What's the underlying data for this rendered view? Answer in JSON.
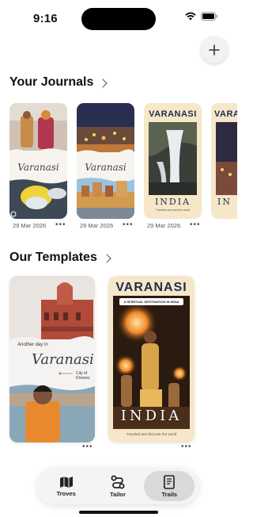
{
  "status": {
    "time": "9:16"
  },
  "journals_section": {
    "title": "Your Journals"
  },
  "journals": [
    {
      "script_title": "Varanasi",
      "date": "29 Mar 2026"
    },
    {
      "script_title": "Varanasi",
      "date": "29 Mar 2026"
    },
    {
      "header": "VARANASI",
      "footer": "INDIA",
      "caption": "Traveled and love this world",
      "date": "29 Mar 2026"
    },
    {
      "header": "VARA",
      "footer": "IN",
      "date": ""
    }
  ],
  "templates_section": {
    "title": "Our Templates"
  },
  "templates": [
    {
      "line1": "Another day in",
      "script_title": "Varanasi",
      "tag": "City of Dreams"
    },
    {
      "header": "VARANASI",
      "banner": "A SPIRITUAL DESTINATION IN INDIA",
      "footer": "INDIA",
      "caption": "Traveled and discover the world"
    }
  ],
  "more_label": "•••",
  "tabs": [
    {
      "label": "Troves",
      "icon": "map-icon"
    },
    {
      "label": "Tailor",
      "icon": "route-icon"
    },
    {
      "label": "Trails",
      "icon": "journal-icon",
      "active": true
    }
  ],
  "colors": {
    "poster_cream": "#f6e7c8",
    "poster_navy": "#1f2b4d",
    "tab_active": "#d9d9d9"
  }
}
